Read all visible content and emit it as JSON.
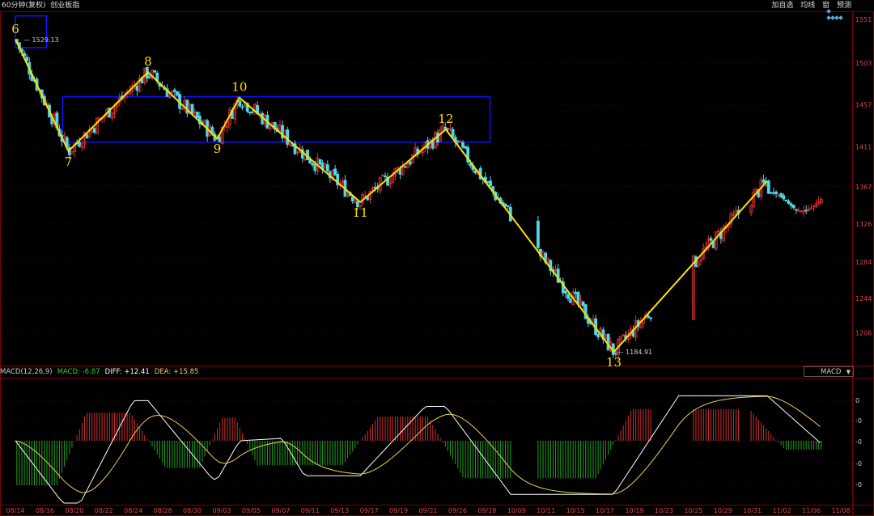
{
  "window": {
    "title": "60分钟(复权)",
    "name": "创业板指",
    "menu": [
      "加自选",
      "均线",
      "窗",
      "预测"
    ]
  },
  "indicator": {
    "label": "MACD(12,26,9)",
    "macd": "MACD: -6.87",
    "diff": "DIFF: +12.41",
    "dea": "DEA: +15.85",
    "selector": "MACD",
    "y_ticks": [
      "0",
      "-0",
      "-0",
      "-0",
      "-0",
      "-0"
    ]
  },
  "colors": {
    "up": "#e03030",
    "down": "#4fd8e8",
    "wave": "#ffe000",
    "box": "#1010ff",
    "grid": "#4a0000",
    "macd_pos": "#d03030",
    "macd_neg": "#20a020",
    "diff": "#ffffff",
    "dea": "#e8d060"
  },
  "chart_data": {
    "type": "candlestick",
    "y_ticks": [
      "1551",
      "1503",
      "1457",
      "1411",
      "1367",
      "1326",
      "1284",
      "1244",
      "1206"
    ],
    "x_ticks": [
      "08/14",
      "08/16",
      "08/20",
      "08/22",
      "08/24",
      "08/28",
      "08/30",
      "09/03",
      "09/05",
      "09/07",
      "09/11",
      "09/13",
      "09/17",
      "09/19",
      "09/21",
      "09/26",
      "09/28",
      "10/09",
      "10/11",
      "10/15",
      "10/17",
      "10/19",
      "10/23",
      "10/25",
      "10/29",
      "10/31",
      "11/02",
      "11/06",
      "11/08"
    ],
    "ylim": [
      1170,
      1560
    ],
    "high_label": "1529.13",
    "low_label": "1184.91",
    "wave_points": [
      {
        "label": "6",
        "date_index": 0,
        "price": 1529
      },
      {
        "label": "7",
        "date_index": 1.8,
        "price": 1406
      },
      {
        "label": "8",
        "date_index": 4.5,
        "price": 1493
      },
      {
        "label": "9",
        "date_index": 6.85,
        "price": 1420
      },
      {
        "label": "10",
        "date_index": 7.6,
        "price": 1465
      },
      {
        "label": "11",
        "date_index": 11.7,
        "price": 1350
      },
      {
        "label": "12",
        "date_index": 14.6,
        "price": 1430
      },
      {
        "label": "13",
        "date_index": 20.3,
        "price": 1185
      },
      {
        "label": "",
        "date_index": 25.5,
        "price": 1373
      }
    ],
    "zones": [
      {
        "from_index": 1.6,
        "to_index": 16.1,
        "low": 1416,
        "high": 1466
      },
      {
        "from_index": 0,
        "to_index": 1.05,
        "low": 1520,
        "high": 1555
      }
    ]
  }
}
